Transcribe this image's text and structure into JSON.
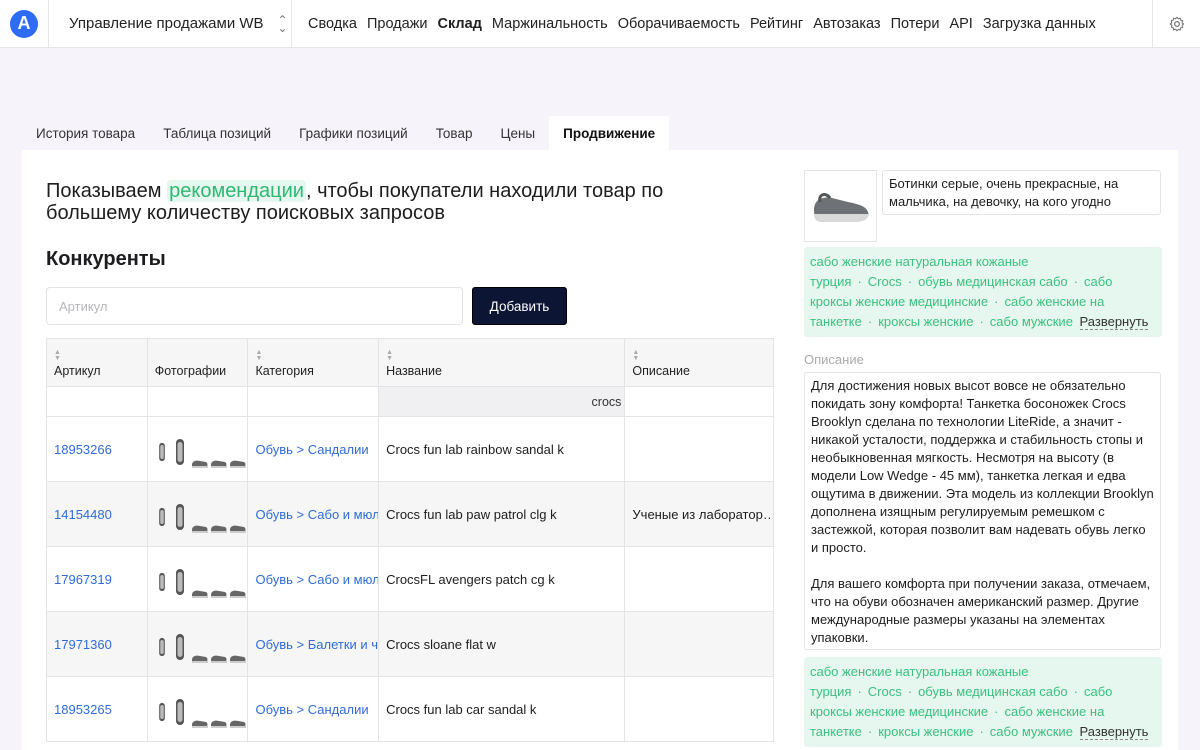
{
  "app": {
    "logo_letter": "A",
    "workspace": "Управление продажами WB",
    "accent": "#2f6cf6"
  },
  "nav": [
    {
      "label": "Сводка",
      "active": false
    },
    {
      "label": "Продажи",
      "active": false
    },
    {
      "label": "Склад",
      "active": true
    },
    {
      "label": "Маржинальность",
      "active": false
    },
    {
      "label": "Оборачиваемость",
      "active": false
    },
    {
      "label": "Рейтинг",
      "active": false
    },
    {
      "label": "Автозаказ",
      "active": false
    },
    {
      "label": "Потери",
      "active": false
    },
    {
      "label": "API",
      "active": false
    },
    {
      "label": "Загрузка данных",
      "active": false
    }
  ],
  "subtabs": [
    {
      "label": "История товара",
      "active": false
    },
    {
      "label": "Таблица позиций",
      "active": false
    },
    {
      "label": "Графики позиций",
      "active": false
    },
    {
      "label": "Товар",
      "active": false
    },
    {
      "label": "Цены",
      "active": false
    },
    {
      "label": "Продвижение",
      "active": true
    }
  ],
  "main": {
    "headline_before": "Показываем ",
    "headline_highlight": "рекомендации",
    "headline_after": ", чтобы покупатели находили товар по большему количеству поисковых запросов",
    "competitors_title": "Конкуренты",
    "article_placeholder": "Артикул",
    "add_button": "Добавить"
  },
  "table": {
    "columns": [
      "Артикул",
      "Фотографии",
      "Категория",
      "Название",
      "Описание"
    ],
    "filter_name": "crocs",
    "rows": [
      {
        "article": "18953266",
        "category": "Обувь > Сандалии",
        "name": "Crocs fun lab rainbow sandal k",
        "description": ""
      },
      {
        "article": "14154480",
        "category": "Обувь > Сабо и мюли",
        "name": "Crocs fun lab paw patrol clg k",
        "description": "Ученые из лаборатор…"
      },
      {
        "article": "17967319",
        "category": "Обувь > Сабо и мюли",
        "name": "CrocsFL avengers patch cg k",
        "description": ""
      },
      {
        "article": "17971360",
        "category": "Обувь > Балетки и че",
        "name": "Crocs sloane flat w",
        "description": ""
      },
      {
        "article": "18953265",
        "category": "Обувь > Сандалии",
        "name": "Crocs fun lab car sandal k",
        "description": ""
      }
    ]
  },
  "product": {
    "title": "Ботинки серые, очень прекрасные, на мальчика, на девочку, на кого угодно",
    "description_label": "Описание",
    "description_p1": "Для достижения новых высот вовсе не обязательно покидать зону комфорта! Танкетка босоножек Crocs Brooklyn сделана по технологии LiteRide, а значит - никакой усталости, поддержка и стабильность стопы и необыкновенная мягкость. Несмотря на высоту (в модели Low Wedge - 45 мм), танкетка легкая и едва ощутима в движении. Эта модель из коллекции Brooklyn дополнена изящным регулируемым ремешком с застежкой, которая позволит вам надевать обувь легко и просто.",
    "description_p2": "Для вашего комфорта при получении заказа, отмечаем, что на обуви обозначен американский размер. Другие международные размеры указаны на элементах упаковки.",
    "expand_label": "Развернуть"
  },
  "keywords": [
    "сабо женские натуральная кожаные турция",
    "Crocs",
    "обувь медицинская сабо",
    "сабо кроксы женские медицинские",
    "сабо женские на танкетке",
    "кроксы женские",
    "сабо мужские"
  ],
  "icons": {
    "settings": "gear-icon",
    "workspace_switch": "chevron-updown-icon",
    "sort": "sort-arrows-icon"
  }
}
